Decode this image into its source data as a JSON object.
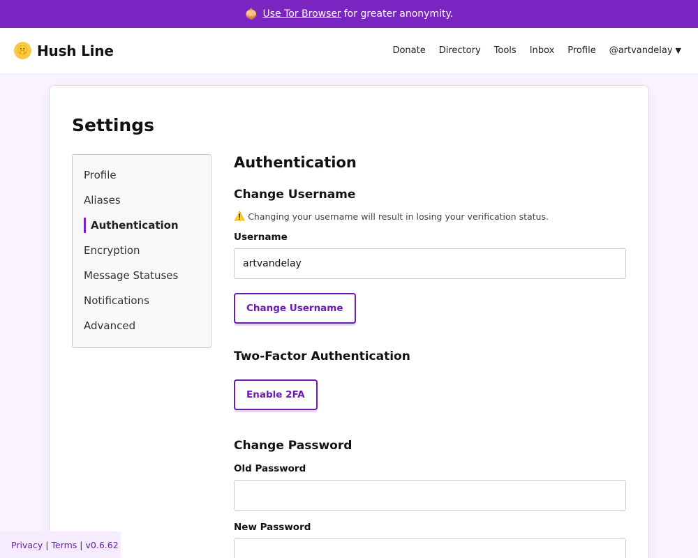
{
  "banner": {
    "icon": "onion-icon",
    "link_text": "Use Tor Browser",
    "suffix": "for greater anonymity."
  },
  "header": {
    "brand": "Hush Line",
    "brand_icon": "shushing-face-icon",
    "nav": [
      "Donate",
      "Directory",
      "Tools",
      "Inbox",
      "Profile"
    ],
    "user": "@artvandelay",
    "user_caret": "▼"
  },
  "settings": {
    "title": "Settings",
    "sidebar": [
      {
        "label": "Profile",
        "active": false
      },
      {
        "label": "Aliases",
        "active": false
      },
      {
        "label": "Authentication",
        "active": true
      },
      {
        "label": "Encryption",
        "active": false
      },
      {
        "label": "Message Statuses",
        "active": false
      },
      {
        "label": "Notifications",
        "active": false
      },
      {
        "label": "Advanced",
        "active": false
      }
    ]
  },
  "auth": {
    "title": "Authentication",
    "change_username": {
      "title": "Change Username",
      "warning": "Changing your username will result in losing your verification status.",
      "warning_icon": "warning-icon",
      "label": "Username",
      "value": "artvandelay",
      "button": "Change Username"
    },
    "two_factor": {
      "title": "Two-Factor Authentication",
      "button": "Enable 2FA"
    },
    "change_password": {
      "title": "Change Password",
      "old_label": "Old Password",
      "old_value": "",
      "new_label": "New Password",
      "new_value": ""
    }
  },
  "footer": {
    "privacy": "Privacy",
    "sep": "|",
    "terms": "Terms",
    "version": "v0.6.62"
  },
  "colors": {
    "accent": "#7a24c2",
    "button": "#6a1bb0",
    "background": "#f9f2ff"
  }
}
